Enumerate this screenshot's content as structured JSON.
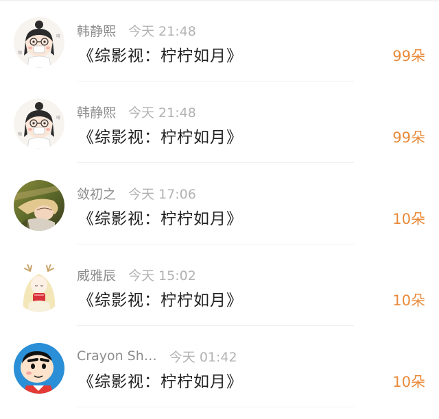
{
  "items": [
    {
      "username": "韩静熙",
      "time": "今天 21:48",
      "title": "《综影视：柠柠如月》",
      "count": "99朵",
      "avatar": "cartoon-girl-mask-avatar"
    },
    {
      "username": "韩静熙",
      "time": "今天 21:48",
      "title": "《综影视：柠柠如月》",
      "count": "99朵",
      "avatar": "cartoon-girl-mask-avatar"
    },
    {
      "username": "敛初之",
      "time": "今天 17:06",
      "title": "《综影视：柠柠如月》",
      "count": "10朵",
      "avatar": "photo-girl-grass-avatar"
    },
    {
      "username": "威雅辰",
      "time": "今天 15:02",
      "title": "《综影视：柠柠如月》",
      "count": "10朵",
      "avatar": "anime-girl-antlers-avatar"
    },
    {
      "username": "Crayon Sh…",
      "time": "今天 01:42",
      "title": "《综影视：柠柠如月》",
      "count": "10朵",
      "avatar": "crayon-shinchan-avatar"
    }
  ],
  "colors": {
    "count": "#e98a3a",
    "username": "#8d8d8d",
    "time": "#b2b2b2",
    "title": "#222222"
  }
}
